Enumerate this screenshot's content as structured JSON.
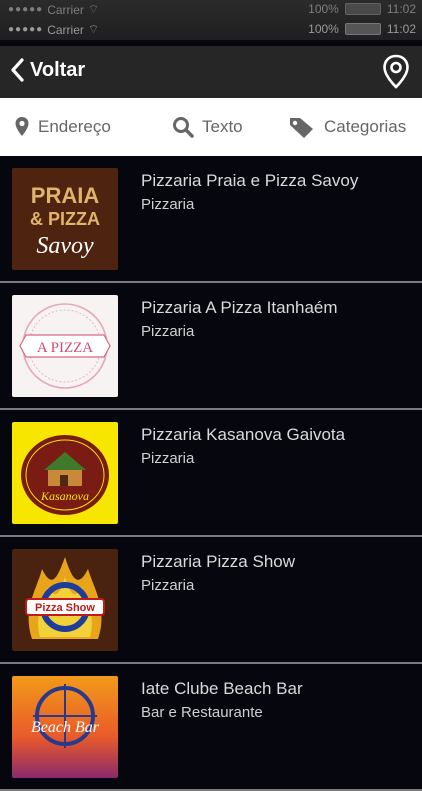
{
  "status": {
    "carrier": "Carrier",
    "battery": "100%",
    "time": "11:02"
  },
  "navbar": {
    "back_label": "Voltar"
  },
  "filters": {
    "address": "Endereço",
    "text": "Texto",
    "categories": "Categorias"
  },
  "places": [
    {
      "name": "Pizzaria Praia e Pizza Savoy",
      "category": "Pizzaria",
      "logo_text_1": "PRAIA",
      "logo_text_2": "& PIZZA",
      "logo_text_3": "Savoy"
    },
    {
      "name": "Pizzaria A Pizza Itanhaém",
      "category": "Pizzaria",
      "logo_text_1": "A PIZZA"
    },
    {
      "name": "Pizzaria Kasanova Gaivota",
      "category": "Pizzaria",
      "logo_text_1": "Kasanova"
    },
    {
      "name": "Pizzaria Pizza Show",
      "category": "Pizzaria",
      "logo_text_1": "Pizza Show"
    },
    {
      "name": "Iate Clube Beach Bar",
      "category": "Bar e Restaurante",
      "logo_text_1": "Beach Bar"
    }
  ],
  "colors": {
    "background": "#06060f",
    "navbar": "#262626",
    "divider": "#7b7b7b",
    "kasanova_yellow": "#f6e600"
  }
}
